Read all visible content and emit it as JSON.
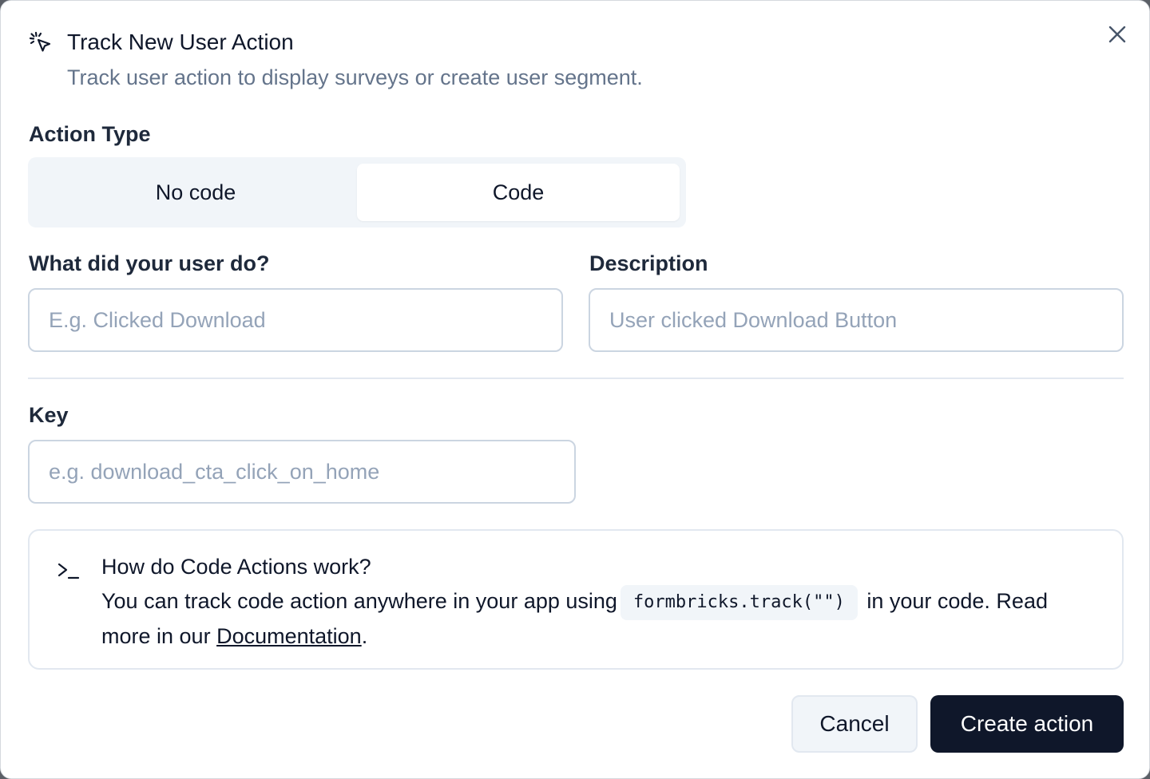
{
  "dialog": {
    "title": "Track New User Action",
    "subtitle": "Track user action to display surveys or create user segment.",
    "header_icon": "mouse-pointer-click-icon",
    "close_icon": "close-icon"
  },
  "action_type": {
    "label": "Action Type",
    "options": [
      {
        "label": "No code",
        "selected": false
      },
      {
        "label": "Code",
        "selected": true
      }
    ]
  },
  "fields": {
    "name": {
      "label": "What did your user do?",
      "value": "",
      "placeholder": "E.g. Clicked Download"
    },
    "description": {
      "label": "Description",
      "value": "",
      "placeholder": "User clicked Download Button"
    },
    "key": {
      "label": "Key",
      "value": "",
      "placeholder": "e.g. download_cta_click_on_home"
    }
  },
  "info": {
    "icon": "terminal-icon",
    "title": "How do Code Actions work?",
    "text_before": "You can track code action anywhere in your app using",
    "code": "formbricks.track(\"\")",
    "text_middle": "in your code. Read more in our",
    "link": "Documentation",
    "text_after": "."
  },
  "buttons": {
    "cancel": "Cancel",
    "create": "Create action"
  },
  "colors": {
    "primary": "#0f172a",
    "muted": "#64748b",
    "placeholder": "#94a3b8",
    "border": "#cbd5e1",
    "surface": "#f1f5f9"
  }
}
